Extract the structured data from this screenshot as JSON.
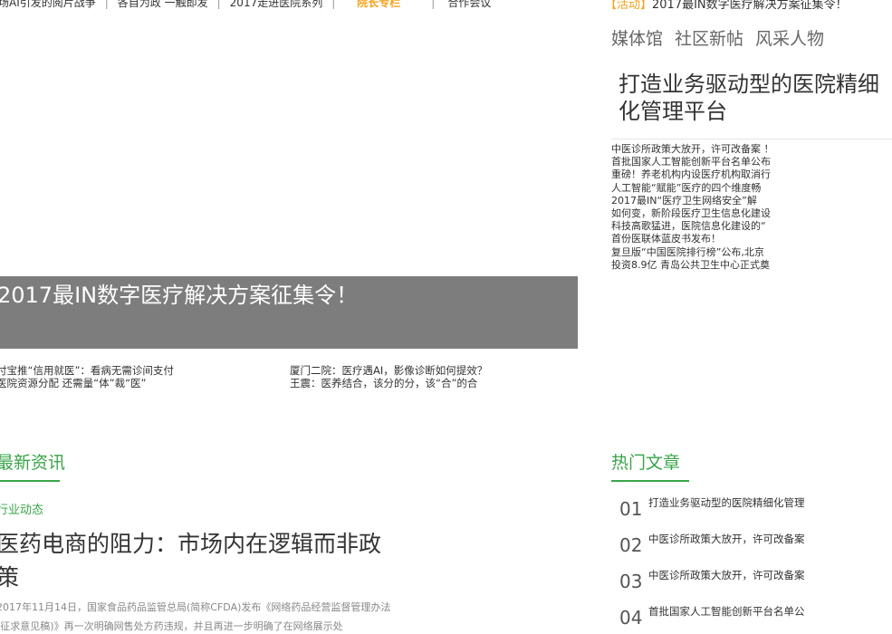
{
  "top_nav": {
    "items": [
      "场AI引发的阅片战争",
      "各自为政 一触即发",
      "2017走进医院系列"
    ],
    "highlight": "院长专栏",
    "last": "合作会议"
  },
  "activity": {
    "tag": "【活动】",
    "text": "2017最IN数字医疗解决方案征集令！"
  },
  "subnav": [
    "媒体馆",
    "社区新帖",
    "风采人物"
  ],
  "feature_title": "打造业务驱动型的医院精细化管理平台",
  "right_list": [
    "中医诊所政策大放开，许可改备案 ！",
    "首批国家人工智能创新平台名单公布",
    "重磅！养老机构内设医疗机构取消行",
    "人工智能“赋能”医疗的四个维度畅",
    "2017最IN“医疗卫生网络安全”解",
    "如何变，新阶段医疗卫生信息化建设",
    "科技高歌猛进，医院信息化建设的“",
    "首份医联体蓝皮书发布！",
    "复旦版“中国医院排行榜”公布,北京",
    "投资8.9亿 青岛公共卫生中心正式奠"
  ],
  "banner_title": "2017最IN数字医疗解决方案征集令！",
  "links_left": [
    "付宝推“信用就医”：看病无需诊间支付",
    "医院资源分配 还需量“体”裁“医”"
  ],
  "links_right": [
    "厦门二院：医疗遇AI，影像诊断如何提效？",
    "王震：医养结合，该分的分，该“合”的合"
  ],
  "news_section": "最新资讯",
  "category": "行业动态",
  "article_title": "医药电商的阻力：市场内在逻辑而非政策",
  "excerpt": "2017年11月14日，国家食品药品监管总局(简称CFDA)发布《网络药品经营监督管理办法(征求意见稿)》再一次明确网售处方药违规，并且再进一步明确了在网络展示处",
  "hot_section": "热门文章",
  "hot_list": [
    {
      "num": "01",
      "text": "打造业务驱动型的医院精细化管理"
    },
    {
      "num": "02",
      "text": "中医诊所政策大放开，许可改备案"
    },
    {
      "num": "03",
      "text": "中医诊所政策大放开，许可改备案"
    },
    {
      "num": "04",
      "text": "首批国家人工智能创新平台名单公"
    }
  ]
}
